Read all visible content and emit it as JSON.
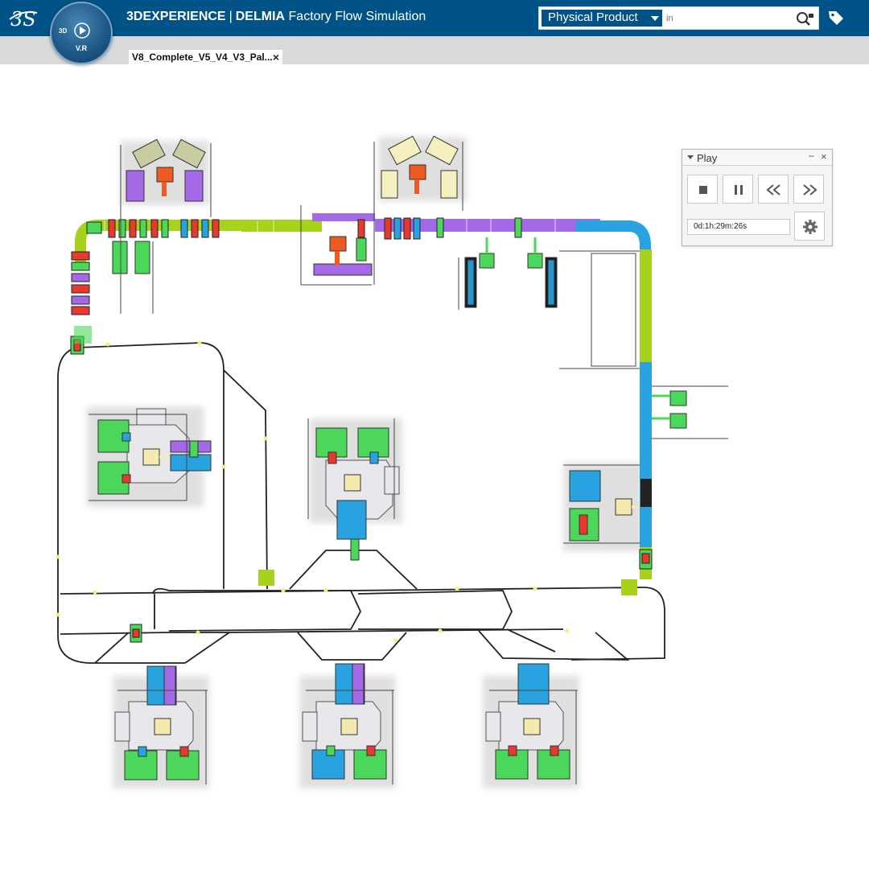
{
  "header": {
    "brand": "3DEXPERIENCE",
    "separator": "|",
    "product": "DELMIA",
    "app_name": "Factory Flow Simulation",
    "compass_label": "V.R",
    "compass_3d": "3D"
  },
  "search": {
    "scope": "Physical Product",
    "placeholder": "in"
  },
  "tabs": [
    {
      "label": "V8_Complete_V5_V4_V3_Pal...",
      "close": "×"
    }
  ],
  "play_panel": {
    "title": "Play",
    "minimize": "–",
    "close": "×",
    "buttons": [
      "stop-icon",
      "pause-icon",
      "rewind-icon",
      "fast-forward-icon"
    ],
    "time": "0d:1h:29m:26s",
    "settings": "gear-icon"
  },
  "colors": {
    "header_bg": "#005386",
    "conveyor_green": "#a6d21c",
    "conveyor_blue": "#29a3e0",
    "conveyor_purple": "#a469e6",
    "machine_green": "#4bd85a",
    "part_red": "#e8392f",
    "robot_orange": "#ee5a22"
  }
}
